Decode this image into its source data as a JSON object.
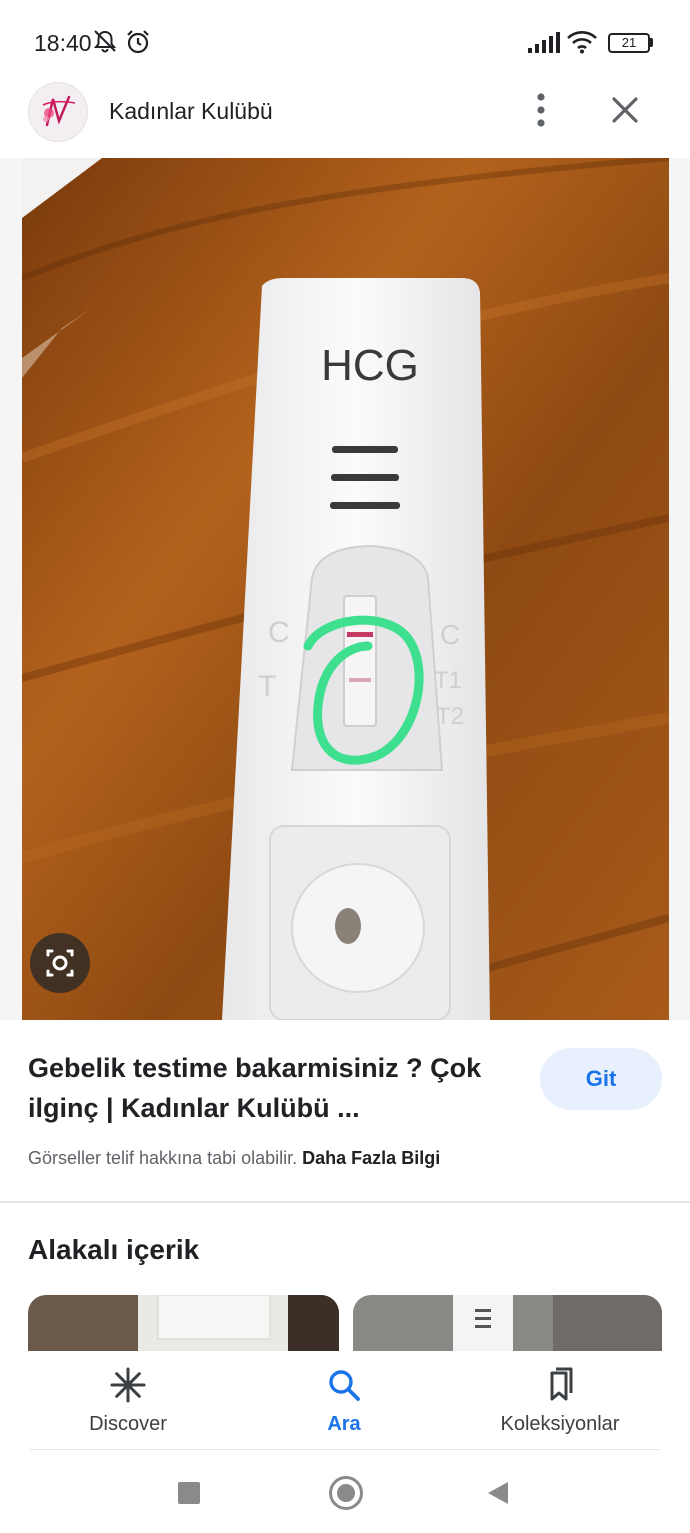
{
  "status_bar": {
    "time": "18:40",
    "battery": "21",
    "icons": [
      "mute-bell-icon",
      "alarm-icon",
      "signal-icon",
      "wifi-icon",
      "battery-icon"
    ]
  },
  "header": {
    "site_name": "Kadınlar Kulübü",
    "logo_icon": "site-logo-icon",
    "more_icon": "more-vertical-icon",
    "close_icon": "close-icon"
  },
  "image": {
    "test_label": "HCG",
    "marks_left": [
      "C",
      "T"
    ],
    "marks_right": [
      "C",
      "T1",
      "T2"
    ],
    "lens_icon": "lens-icon"
  },
  "result": {
    "title": "Gebelik testime bakarmisiniz ? Çok ilginç | Kadınlar Kulübü ...",
    "go_label": "Git",
    "copyright_text": "Görseller telif hakkına tabi olabilir.",
    "more_info_link": "Daha Fazla Bilgi"
  },
  "related": {
    "title": "Alakalı içerik"
  },
  "bottom_nav": {
    "items": [
      {
        "label": "Discover",
        "icon": "asterisk-icon",
        "active": false
      },
      {
        "label": "Ara",
        "icon": "search-icon",
        "active": true
      },
      {
        "label": "Koleksiyonlar",
        "icon": "collections-icon",
        "active": false
      }
    ]
  },
  "system_nav": {
    "icons": [
      "recent-apps-icon",
      "home-icon",
      "back-icon"
    ]
  },
  "colors": {
    "accent": "#1a73e8",
    "go_button_bg": "#e8f0fe",
    "highlight_circle": "#3ee08f"
  }
}
